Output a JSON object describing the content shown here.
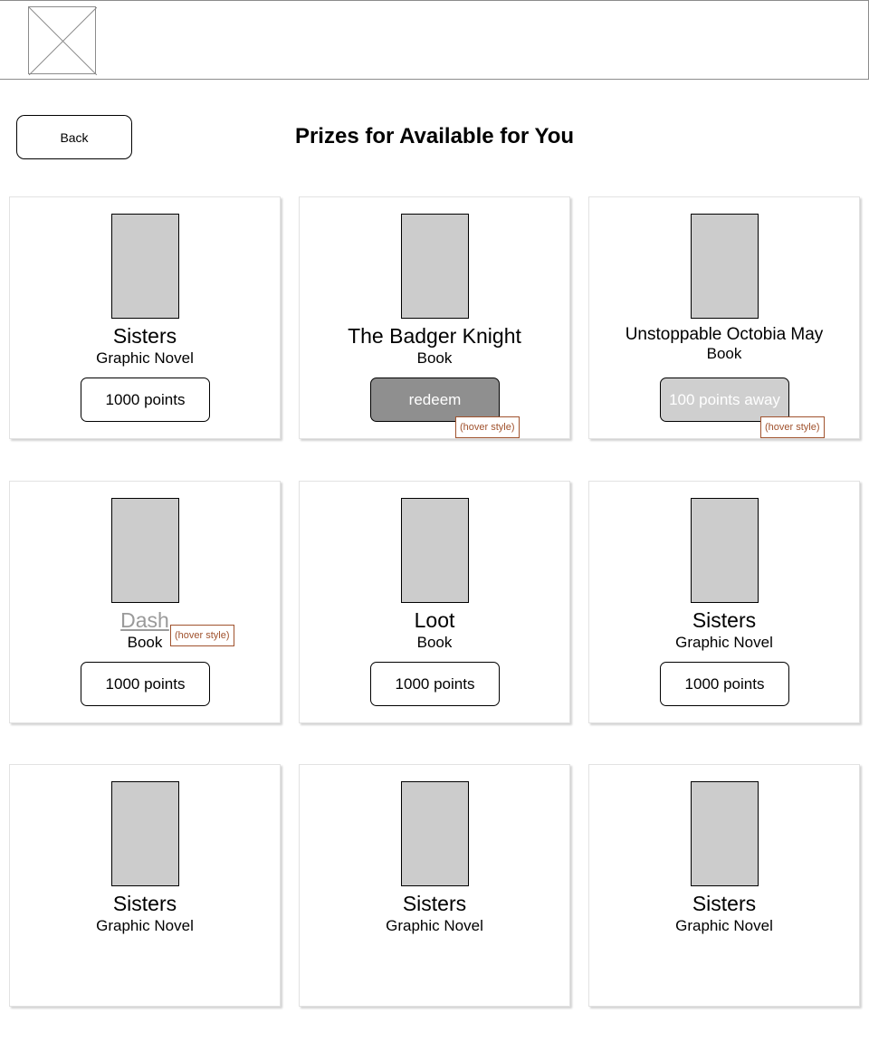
{
  "header": {
    "logo_icon": "image-placeholder-icon"
  },
  "nav": {
    "back_label": "Back"
  },
  "page": {
    "title": "Prizes for Available for You"
  },
  "annotation": {
    "hover_note": "(hover style)"
  },
  "prizes": [
    {
      "title": "Sisters",
      "type": "Graphic Novel",
      "button": "1000 points",
      "button_state": "normal"
    },
    {
      "title": "The Badger Knight",
      "type": "Book",
      "button": "redeem",
      "button_state": "hover"
    },
    {
      "title": "Unstoppable Octobia May",
      "type": "Book",
      "button": "100 points away",
      "button_state": "disabled"
    },
    {
      "title": "Dash",
      "type": "Book",
      "button": "1000 points",
      "button_state": "normal",
      "title_state": "hover"
    },
    {
      "title": "Loot",
      "type": "Book",
      "button": "1000 points",
      "button_state": "normal"
    },
    {
      "title": "Sisters",
      "type": "Graphic Novel",
      "button": "1000 points",
      "button_state": "normal"
    },
    {
      "title": "Sisters",
      "type": "Graphic Novel"
    },
    {
      "title": "Sisters",
      "type": "Graphic Novel"
    },
    {
      "title": "Sisters",
      "type": "Graphic Novel"
    }
  ],
  "colors": {
    "thumbnail": "#cccccc",
    "redeem_hover": "#8f8f8f",
    "points_away": "#cfcfcf",
    "annotation": "#a0522d"
  }
}
